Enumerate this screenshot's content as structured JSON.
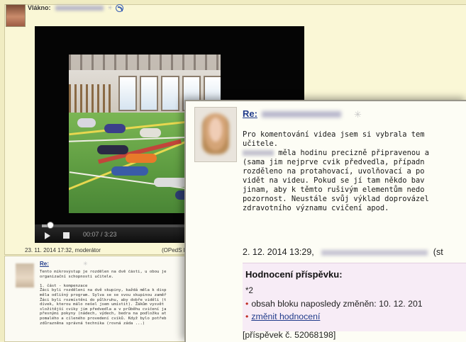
{
  "background_post": {
    "thread_label": "Vlákno:",
    "meta_left": "23. 11. 2014 17:32, moderátor",
    "meta_right": "(OPedS K",
    "video": {
      "time_display": "00:07 / 3:23",
      "progress": 0.04
    }
  },
  "second_post": {
    "re_label": "Re:",
    "text": "Tento mikrovýstup je rozdělen na dvě části, u obou je\norganizační schopnosti učitele.\n\n1. část - kompenzace\nŽáci byli rozděleni na dvě skupiny, každá měla k disp\nměla odlišný program. Sylva se se svou skupinou zaměř\nŽáci byli rozmístěni do půlkruhu, aby dobře viděli (t\ndívek, kterou málo nešel jsem umístit). Žákům vysvět\nsložitější cviky jim předvedla a v průběhu cvičení ja\npřesnými pokyny (nádech, výdech, bedra na podložku at\npomalého a cíleného provedení cviků. Když bylo potřeb\nzdůrazněna správná technika (rovná záda ...)"
  },
  "front_post": {
    "re_label": "Re:",
    "body_line1": "Pro komentování videa jsem si vybrala tem",
    "body_line2": "učitele.",
    "body_line3_suffix": " měla hodinu precizně připravenou a",
    "body_line4": "(sama jim nejprve cvik předvedla, případn",
    "body_line5": "rozděleno na protahovací, uvolňovací a po",
    "body_line6": "vidět na videu. Pokud se jí tam někdo bav",
    "body_line7": "jinam, aby k těmto rušivým elementům nedo",
    "body_line8": "pozornost. Neustále svůj výklad doprovázel",
    "body_line9": "zdravotního významu cvičení apod.",
    "date": "2. 12. 2014 13:29,",
    "date_suffix": "(st",
    "rating": {
      "title": "Hodnocení příspěvku:",
      "value": "*2",
      "last_changed": "obsah bloku naposledy změněn: 10. 12. 201",
      "change_link": "změnit hodnocení"
    },
    "post_number": "[příspěvek č. 52068198]"
  },
  "colors": {
    "page_bg": "#f0ecc2",
    "link": "#1f3a8a",
    "bullet": "#c0281f",
    "rating_bg": "#f7ecf6"
  },
  "icons": [
    "star-icon",
    "rss-icon",
    "play-icon",
    "stop-icon"
  ]
}
